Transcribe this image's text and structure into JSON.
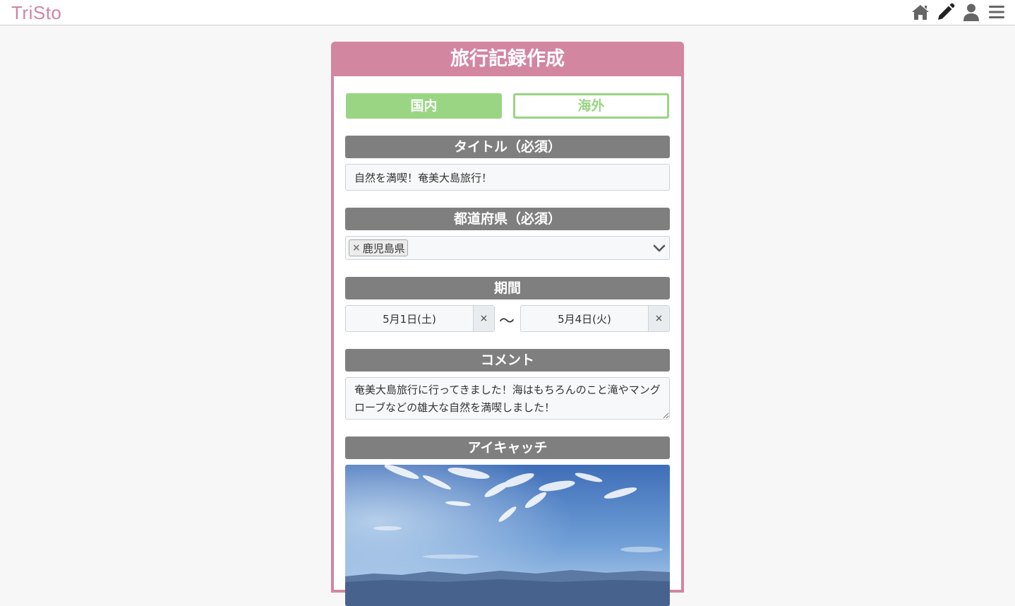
{
  "app": {
    "logo": "TriSto"
  },
  "nav": {
    "icons": [
      "home-icon",
      "pencil-icon",
      "user-icon",
      "menu-icon"
    ]
  },
  "card": {
    "title": "旅行記録作成"
  },
  "region_toggle": {
    "domestic": "国内",
    "overseas": "海外",
    "selected": "国内"
  },
  "fields": {
    "title": {
      "label": "タイトル（必須）",
      "value": "自然を満喫！奄美大島旅行！"
    },
    "prefecture": {
      "label": "都道府県（必須）",
      "selected_tag": "鹿児島県",
      "remove_glyph": "×"
    },
    "period": {
      "label": "期間",
      "start": "5月1日(土)",
      "end": "5月4日(火)",
      "separator": "〜",
      "clear_glyph": "×"
    },
    "comment": {
      "label": "コメント",
      "value": "奄美大島旅行に行ってきました！海はもちろんのこと滝やマングローブなどの雄大な自然を満喫しました！"
    },
    "eyecatch": {
      "label": "アイキャッチ"
    }
  },
  "colors": {
    "brand": "#d3869f",
    "toggle_green": "#99d583",
    "section_gray": "#7f7f7f"
  }
}
